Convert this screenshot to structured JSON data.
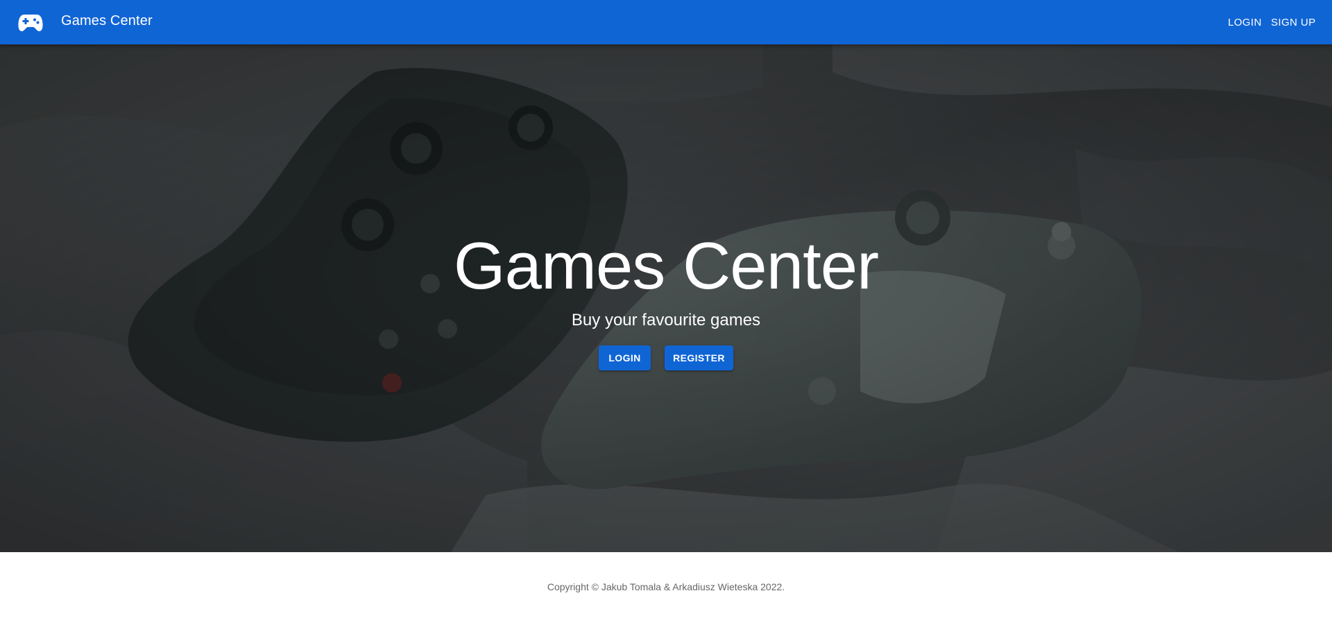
{
  "header": {
    "brand_icon": "gamepad-icon",
    "title": "Games Center",
    "nav": {
      "login_label": "LOGIN",
      "signup_label": "SIGN UP"
    },
    "background_color": "#1065d5"
  },
  "hero": {
    "title": "Games Center",
    "subtitle": "Buy your favourite games",
    "login_label": "LOGIN",
    "register_label": "REGISTER",
    "background_image": "game-controllers-on-blanket-photo"
  },
  "footer": {
    "copyright": "Copyright © Jakub Tomala & Arkadiusz Wieteska 2022."
  },
  "colors": {
    "primary": "#1065d5",
    "footer_text": "#666666"
  }
}
